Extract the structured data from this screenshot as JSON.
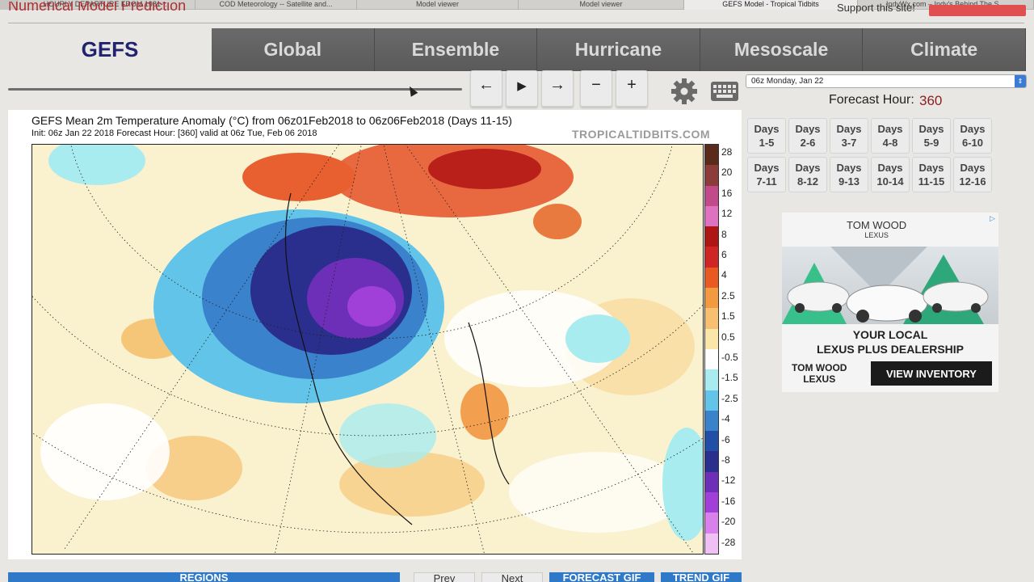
{
  "browser": {
    "tabs": [
      {
        "label": "HOURLY DEPARTURE FROM 1981-..."
      },
      {
        "label": "COD Meteorology -- Satellite and..."
      },
      {
        "label": "Model viewer"
      },
      {
        "label": "Model viewer"
      },
      {
        "label": "GEFS Model - Tropical Tidbits"
      },
      {
        "label": "IndyWx.com – Indy's Behind The S..."
      }
    ]
  },
  "header": {
    "site_title": "Numerical Model Prediction",
    "support_text": "Support this site!"
  },
  "nav": {
    "current": "GEFS",
    "items": [
      {
        "label": "Global"
      },
      {
        "label": "Ensemble"
      },
      {
        "label": "Hurricane"
      },
      {
        "label": "Mesoscale"
      },
      {
        "label": "Climate"
      }
    ]
  },
  "controls": {
    "prev_label": "←",
    "play_label": "▶",
    "next_label": "→",
    "minus_label": "−",
    "plus_label": "+",
    "slider_progress": 0.9
  },
  "run": {
    "selected": "06z Monday, Jan 22",
    "forecast_hour_label": "Forecast Hour:",
    "forecast_hour_value": "360"
  },
  "day_ranges": [
    "Days\n1-5",
    "Days\n2-6",
    "Days\n3-7",
    "Days\n4-8",
    "Days\n5-9",
    "Days\n6-10",
    "Days\n7-11",
    "Days\n8-12",
    "Days\n9-13",
    "Days\n10-14",
    "Days\n11-15",
    "Days\n12-16"
  ],
  "ad": {
    "brand": "TOM WOOD",
    "brand_sub": "LEXUS",
    "headline_1": "YOUR LOCAL",
    "headline_2": "LEXUS PLUS DEALERSHIP",
    "logo_1": "TOM WOOD",
    "logo_2": "LEXUS",
    "cta": "VIEW INVENTORY"
  },
  "map": {
    "title": "GEFS Mean 2m Temperature Anomaly (°C) from 06z01Feb2018 to 06z06Feb2018 (Days 11-15)",
    "subtitle": "Init: 06z Jan 22 2018   Forecast Hour: [360]   valid at 06z Tue, Feb 06 2018",
    "watermark": "TROPICALTIDBITS.COM",
    "colorbar_labels": [
      "28",
      "20",
      "16",
      "12",
      "8",
      "6",
      "4",
      "2.5",
      "1.5",
      "0.5",
      "-0.5",
      "-1.5",
      "-2.5",
      "-4",
      "-6",
      "-8",
      "-12",
      "-16",
      "-20",
      "-28"
    ],
    "colorbar_colors": [
      "#5a2a1a",
      "#8c3a3a",
      "#c24a8a",
      "#e070c0",
      "#b01515",
      "#d02525",
      "#e85a20",
      "#f39a40",
      "#f7c070",
      "#fae6a8",
      "#ffffff",
      "#a8ecf0",
      "#62c4e8",
      "#3a82cc",
      "#1f4fa6",
      "#2a2e8c",
      "#6e2fb8",
      "#a040d8",
      "#d880ec",
      "#f0c0f4"
    ]
  },
  "bottom": {
    "regions": "REGIONS",
    "prev": "Prev",
    "next": "Next",
    "forecast_gif": "FORECAST GIF",
    "trend_gif": "TREND GIF"
  }
}
